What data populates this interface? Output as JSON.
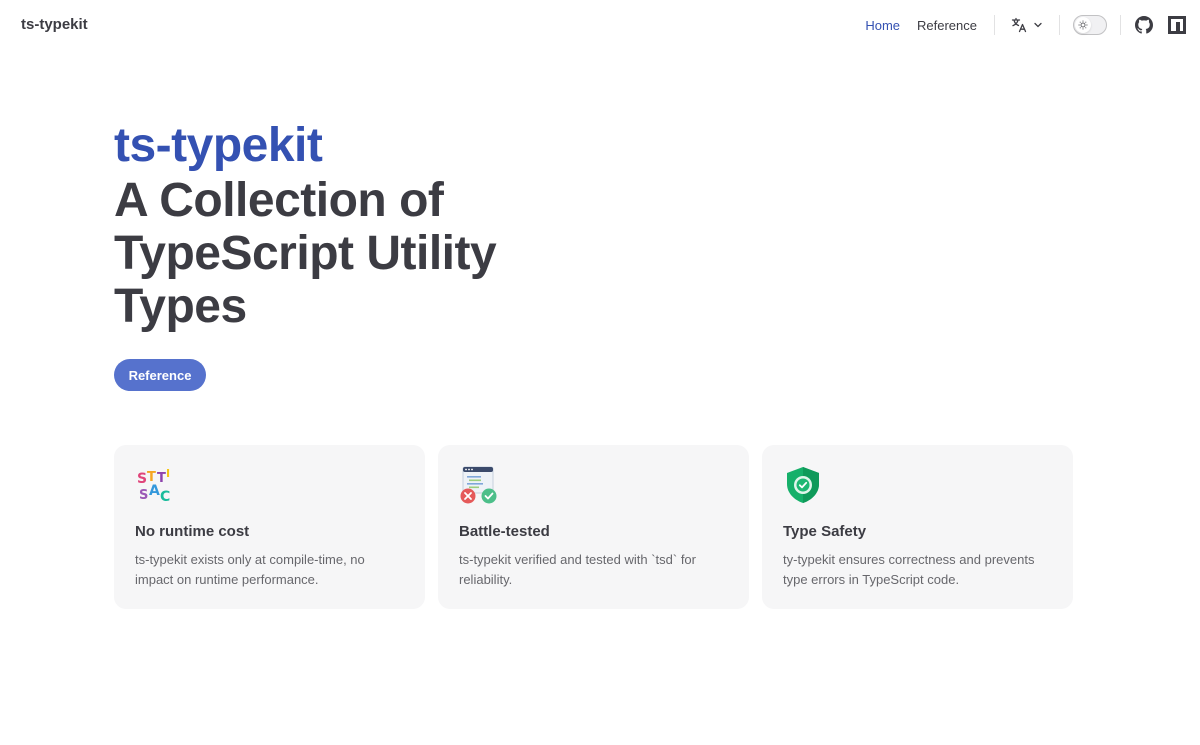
{
  "nav": {
    "site_title": "ts-typekit",
    "links": [
      {
        "label": "Home",
        "active": true
      },
      {
        "label": "Reference",
        "active": false
      }
    ],
    "icons": [
      "translate-icon",
      "chevron-down-icon",
      "theme-switch",
      "github-icon",
      "npm-icon"
    ]
  },
  "hero": {
    "name": "ts-typekit",
    "text_line1": "A Collection of",
    "text_line2": "TypeScript Utility",
    "text_line3": "Types",
    "action_label": "Reference"
  },
  "features": [
    {
      "icon": "static-letters-icon",
      "title": "No runtime cost",
      "details": "ts-typekit exists only at compile-time, no impact on runtime performance."
    },
    {
      "icon": "test-results-icon",
      "title": "Battle-tested",
      "details": "ts-typekit verified and tested with `tsd` for reliability."
    },
    {
      "icon": "shield-check-icon",
      "title": "Type Safety",
      "details": "ty-typekit ensures correctness and prevents type errors in TypeScript code."
    }
  ],
  "colors": {
    "brand": "#3451b2",
    "button": "#5672cd",
    "card_bg": "#f6f6f7",
    "text": "#3c3c43",
    "muted": "#67676c"
  }
}
